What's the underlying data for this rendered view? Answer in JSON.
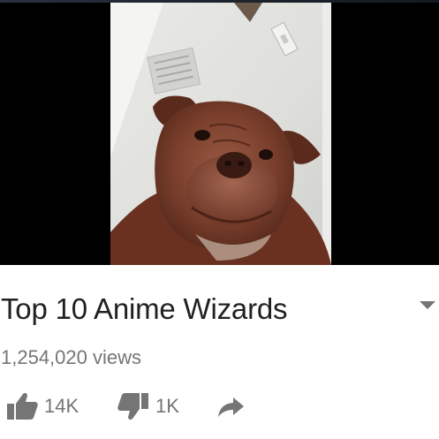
{
  "video": {
    "title": "Top 10 Anime Wizards",
    "views": "1,254,020 views"
  },
  "actions": {
    "like_count": "14K",
    "dislike_count": "1K"
  },
  "icons": {
    "like": "thumbs-up-icon",
    "dislike": "thumbs-down-icon",
    "share": "share-arrow-icon",
    "expand": "chevron-down-icon"
  },
  "colors": {
    "title": "#212121",
    "secondary": "#757575",
    "player_background": "#000000"
  }
}
